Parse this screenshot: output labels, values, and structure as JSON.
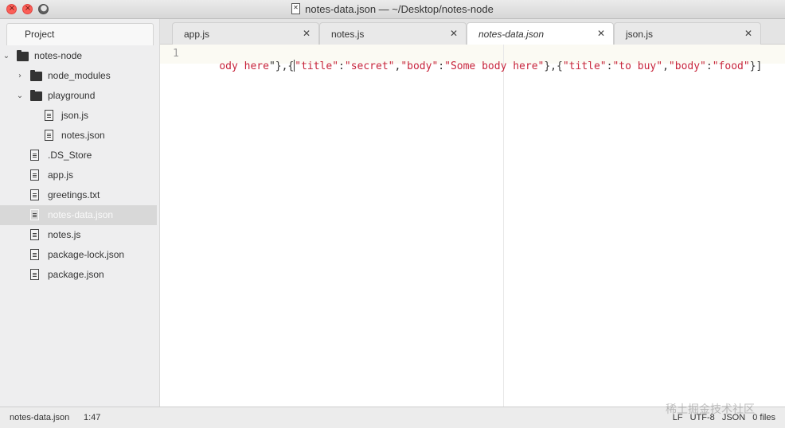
{
  "window": {
    "title": "notes-data.json — ~/Desktop/notes-node"
  },
  "sidebar": {
    "tab_label": "Project",
    "root": "notes-node",
    "items": [
      {
        "label": "node_modules"
      },
      {
        "label": "playground"
      },
      {
        "label": "json.js"
      },
      {
        "label": "notes.json"
      },
      {
        "label": ".DS_Store"
      },
      {
        "label": "app.js"
      },
      {
        "label": "greetings.txt"
      },
      {
        "label": "notes-data.json"
      },
      {
        "label": "notes.js"
      },
      {
        "label": "package-lock.json"
      },
      {
        "label": "package.json"
      }
    ],
    "selected": "notes-data.json"
  },
  "tabs": [
    {
      "label": "app.js",
      "active": false
    },
    {
      "label": "notes.js",
      "active": false
    },
    {
      "label": "notes-data.json",
      "active": true
    },
    {
      "label": "json.js",
      "active": false
    }
  ],
  "tab_close_glyph": "✕",
  "editor": {
    "line_number": "1",
    "segments": [
      {
        "text": "ody here",
        "type": "str"
      },
      {
        "text": "\"},{",
        "type": "punct"
      },
      {
        "text": "\"title\"",
        "type": "str"
      },
      {
        "text": ":",
        "type": "punct"
      },
      {
        "text": "\"secret\"",
        "type": "str"
      },
      {
        "text": ",",
        "type": "punct"
      },
      {
        "text": "\"body\"",
        "type": "str"
      },
      {
        "text": ":",
        "type": "punct"
      },
      {
        "text": "\"Some body here\"",
        "type": "str"
      },
      {
        "text": "},{",
        "type": "punct"
      },
      {
        "text": "\"title\"",
        "type": "str"
      },
      {
        "text": ":",
        "type": "punct"
      },
      {
        "text": "\"to buy\"",
        "type": "str"
      },
      {
        "text": ",",
        "type": "punct"
      },
      {
        "text": "\"body\"",
        "type": "str"
      },
      {
        "text": ":",
        "type": "punct"
      },
      {
        "text": "\"food\"",
        "type": "str"
      },
      {
        "text": "}]",
        "type": "punct"
      }
    ]
  },
  "statusbar": {
    "file": "notes-data.json",
    "position": "1:47",
    "line_ending": "LF",
    "encoding": "UTF-8",
    "grammar": "JSON",
    "files": "0 files"
  },
  "watermark": "稀土掘金技术社区",
  "colors": {
    "string": "#c7243a",
    "close_button": "#fc5f57"
  }
}
